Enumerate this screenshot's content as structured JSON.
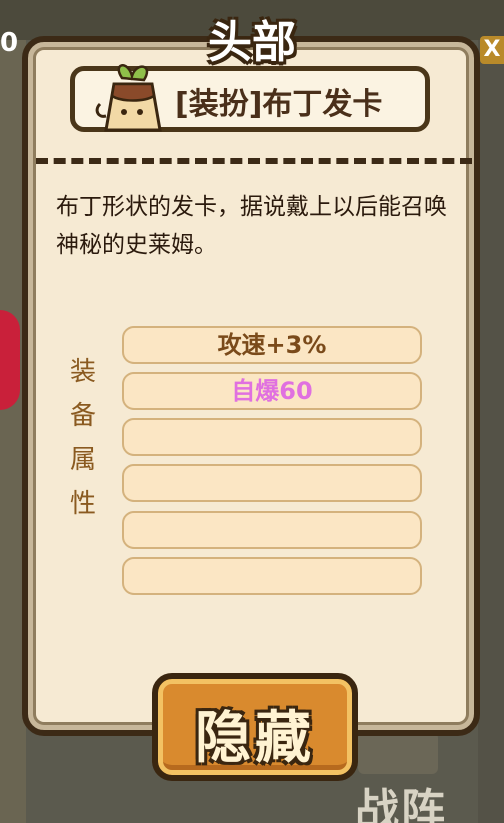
{
  "header": {
    "title": "头部"
  },
  "background": {
    "left_number": "0",
    "right_icon": "X",
    "bottom_label": "战阵"
  },
  "item": {
    "name": "[装扮]布丁发卡",
    "icon": "pudding-hairpin-icon",
    "description": "布丁形状的发卡，据说戴上以后能召唤神秘的史莱姆。"
  },
  "attributes": {
    "label": [
      "装",
      "备",
      "属",
      "性"
    ],
    "rows": [
      {
        "text": "攻速+3%",
        "color": "#7a4a1a"
      },
      {
        "text": "自爆60",
        "color": "#e070e0"
      },
      {
        "text": "",
        "color": "#7a4a1a"
      },
      {
        "text": "",
        "color": "#7a4a1a"
      },
      {
        "text": "",
        "color": "#7a4a1a"
      },
      {
        "text": "",
        "color": "#7a4a1a"
      }
    ]
  },
  "actions": {
    "hide_label": "隐藏"
  }
}
